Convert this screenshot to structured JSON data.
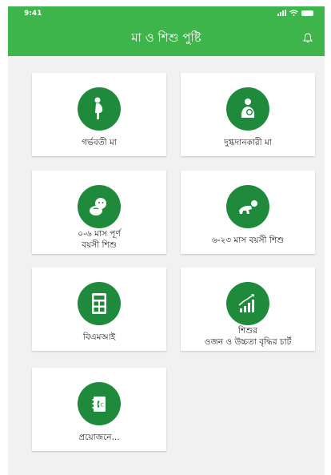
{
  "status_bar": {
    "time": "9:41"
  },
  "header": {
    "title": "মা ও শিশু পুষ্টি",
    "bell_icon": "bell-icon"
  },
  "colors": {
    "header_green": "#3db54a",
    "icon_green": "#1f8a3c",
    "background": "#f1f1f1"
  },
  "cards": [
    {
      "line1": "গর্ভবতী মা",
      "line2": "",
      "icon": "pregnant-mother-icon"
    },
    {
      "line1": "দুগ্ধদানকারী মা",
      "line2": "",
      "icon": "breastfeeding-mother-icon"
    },
    {
      "line1": "০-৬ মাস পূর্ণ",
      "line2": "বয়সী শিশু",
      "icon": "baby-icon"
    },
    {
      "line1": "৬-২৩ মাস বয়সী শিশু",
      "line2": "",
      "icon": "crawling-baby-icon"
    },
    {
      "line1": "বিএমআই",
      "line2": "",
      "icon": "bmi-calculator-icon"
    },
    {
      "line1": "শিশুর",
      "line2": "ওজন ও উচ্চতা বৃদ্ধির চার্ট",
      "icon": "growth-chart-icon"
    },
    {
      "line1": "প্রয়োজনে...",
      "line2": "",
      "icon": "phone-book-icon"
    }
  ]
}
